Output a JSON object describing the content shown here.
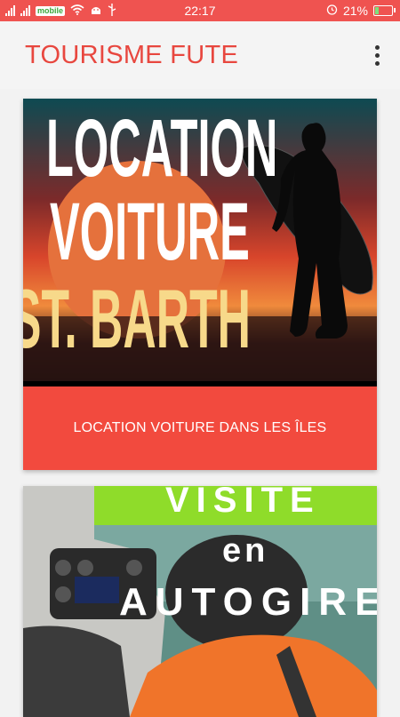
{
  "status_bar": {
    "carrier": "mobile",
    "time": "22:17",
    "battery": "21%",
    "battery_level": 0.21
  },
  "app_bar": {
    "title": "TOURISME FUTE",
    "menu_icon": "more-vert-icon"
  },
  "cards": [
    {
      "image_lines": [
        "LOCATION",
        "VOITURE",
        "ST. BARTH"
      ],
      "caption": "LOCATION VOITURE DANS LES ÎLES"
    },
    {
      "image_lines": [
        "VISITE",
        "en",
        "AUTOGIRE"
      ]
    }
  ],
  "colors": {
    "status_bar": "#ef5350",
    "title": "#e8473f",
    "caption_bg": "#f24a3e",
    "badge_green": "#8fdc2a"
  }
}
